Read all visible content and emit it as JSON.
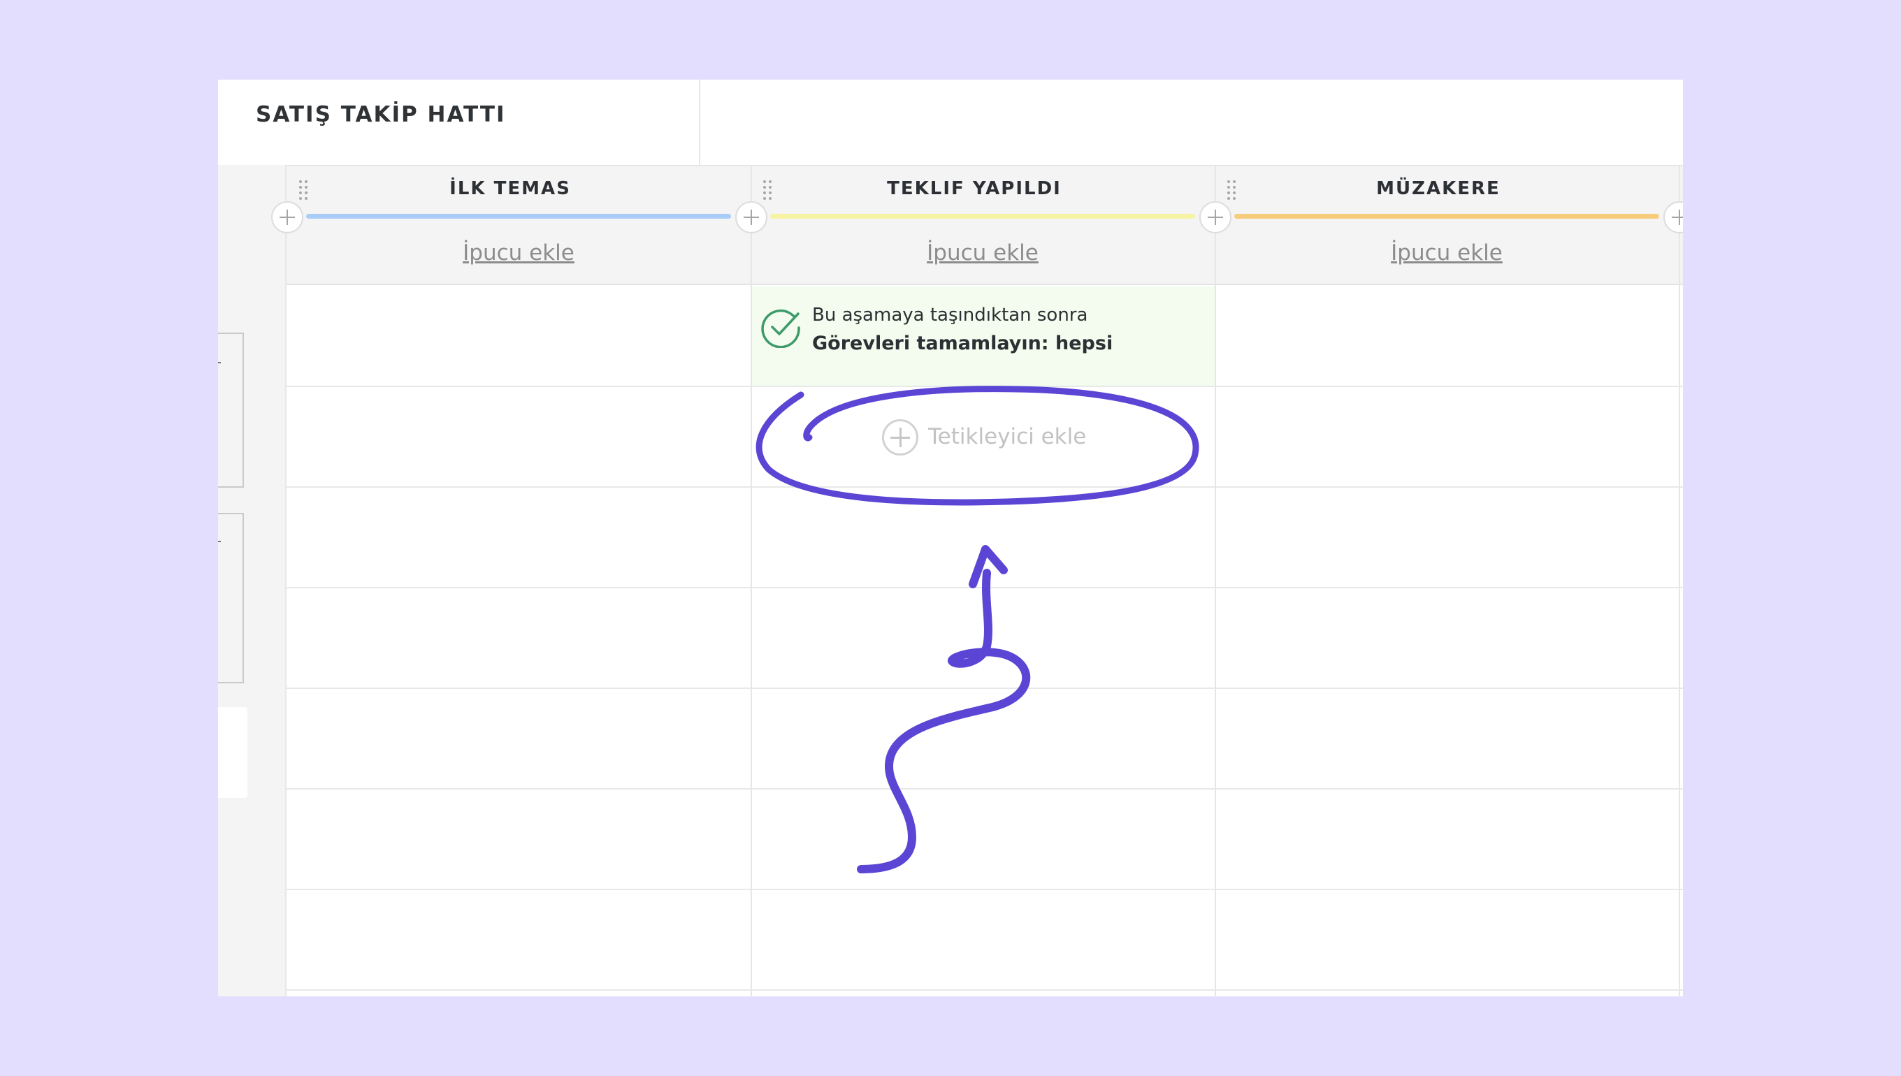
{
  "app": {
    "title": "SATIŞ TAKİP HATTI"
  },
  "stages": [
    {
      "name": "İLK TEMAS",
      "hint_label": "İpucu ekle",
      "color": "#a9cdf7"
    },
    {
      "name": "TEKLIF YAPILDI",
      "hint_label": "İpucu ekle",
      "color": "#f6f3a3",
      "trigger": {
        "line1": "Bu aşamaya taşındıktan sonra",
        "line2": "Görevleri tamamlayın: hepsi"
      },
      "add_trigger_label": "Tetikleyici ekle"
    },
    {
      "name": "MÜZAKERE",
      "hint_label": "İpucu ekle",
      "color": "#f6cd7c"
    }
  ],
  "icons": {
    "drag": "drag-handle-icon",
    "add_stage": "plus-circle-icon",
    "trigger_done": "check-circle-icon",
    "add_trigger": "plus-circle-icon"
  },
  "colors": {
    "background": "#e3defe",
    "annotation": "#5b45d4",
    "check": "#3f9a6a",
    "trigger_bg": "#f3fcee"
  }
}
